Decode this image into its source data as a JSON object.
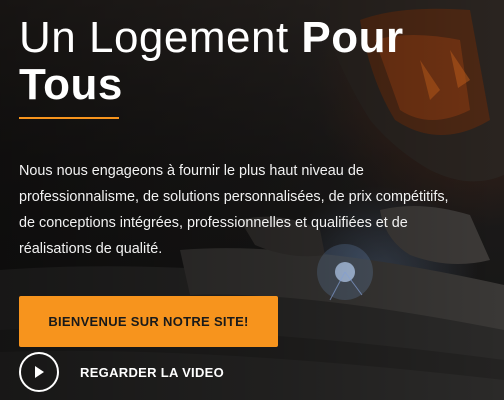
{
  "hero": {
    "title_regular": "Un Logement ",
    "title_bold_line1": "Pour",
    "title_bold_line2": "Tous",
    "description": "Nous nous engageons à fournir le plus haut niveau de professionnalisme, de solutions personnalisées, de prix compétitifs, de conceptions intégrées, professionnelles et qualifiées et de réalisations de qualité.",
    "cta_label": "BIENVENUE SUR NOTRE SITE!",
    "video_label": "REGARDER LA VIDEO",
    "play_icon": "play-icon"
  },
  "colors": {
    "accent": "#f7941d",
    "text": "#ffffff",
    "background": "#1b1b1c"
  }
}
